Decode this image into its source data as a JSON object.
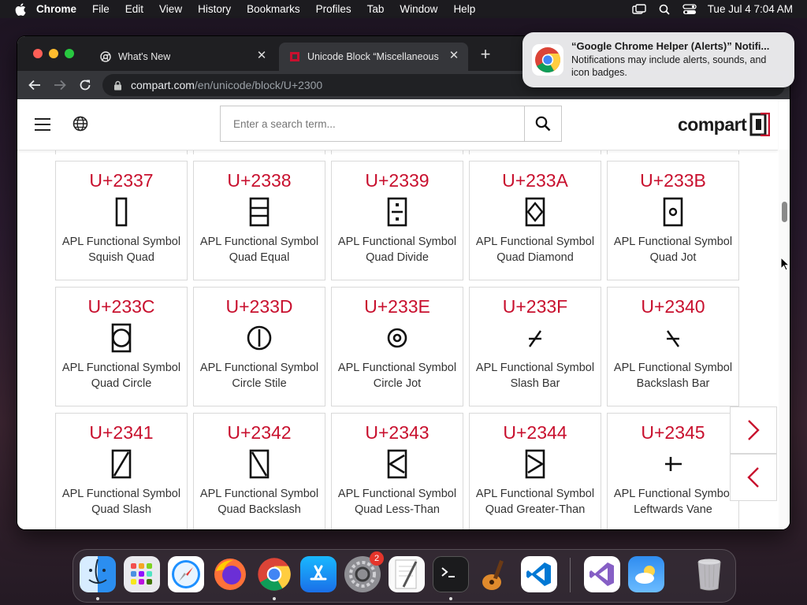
{
  "menubar": {
    "app": "Chrome",
    "items": [
      "File",
      "Edit",
      "View",
      "History",
      "Bookmarks",
      "Profiles",
      "Tab",
      "Window",
      "Help"
    ],
    "datetime": "Tue Jul 4  7:04 AM"
  },
  "browser": {
    "tabs": [
      {
        "label": "What's New",
        "active": false
      },
      {
        "label": "Unicode Block “Miscellaneous",
        "active": true
      }
    ],
    "url_host": "compart.com",
    "url_path": "/en/unicode/block/U+2300"
  },
  "notification": {
    "title": "“Google Chrome Helper (Alerts)” Notifi...",
    "body": "Notifications may include alerts, sounds, and icon badges."
  },
  "site": {
    "search_placeholder": "Enter a search term...",
    "logo_text": "compart"
  },
  "cards": [
    {
      "code": "U+2337",
      "name": "APL Functional Symbol Squish Quad",
      "glyph": "squish-quad"
    },
    {
      "code": "U+2338",
      "name": "APL Functional Symbol Quad Equal",
      "glyph": "quad-equal"
    },
    {
      "code": "U+2339",
      "name": "APL Functional Symbol Quad Divide",
      "glyph": "quad-divide"
    },
    {
      "code": "U+233A",
      "name": "APL Functional Symbol Quad Diamond",
      "glyph": "quad-diamond"
    },
    {
      "code": "U+233B",
      "name": "APL Functional Symbol Quad Jot",
      "glyph": "quad-jot"
    },
    {
      "code": "U+233C",
      "name": "APL Functional Symbol Quad Circle",
      "glyph": "quad-circle"
    },
    {
      "code": "U+233D",
      "name": "APL Functional Symbol Circle Stile",
      "glyph": "circle-stile"
    },
    {
      "code": "U+233E",
      "name": "APL Functional Symbol Circle Jot",
      "glyph": "circle-jot"
    },
    {
      "code": "U+233F",
      "name": "APL Functional Symbol Slash Bar",
      "glyph": "slash-bar"
    },
    {
      "code": "U+2340",
      "name": "APL Functional Symbol Backslash Bar",
      "glyph": "backslash-bar"
    },
    {
      "code": "U+2341",
      "name": "APL Functional Symbol Quad Slash",
      "glyph": "quad-slash"
    },
    {
      "code": "U+2342",
      "name": "APL Functional Symbol Quad Backslash",
      "glyph": "quad-backslash"
    },
    {
      "code": "U+2343",
      "name": "APL Functional Symbol Quad Less-Than",
      "glyph": "quad-less-than"
    },
    {
      "code": "U+2344",
      "name": "APL Functional Symbol Quad Greater-Than",
      "glyph": "quad-greater-than"
    },
    {
      "code": "U+2345",
      "name": "APL Functional Symbol Leftwards Vane",
      "glyph": "leftwards-vane"
    }
  ],
  "dock": {
    "apps": [
      "Finder",
      "Launchpad",
      "Safari",
      "Firefox",
      "Google Chrome",
      "App Store",
      "System Settings",
      "TextEdit",
      "Terminal",
      "GarageBand",
      "Visual Studio Code",
      "Visual Studio",
      "Weather",
      "Trash"
    ],
    "settings_badge": "2"
  },
  "colors": {
    "accent": "#c8102e",
    "tab_bar": "#1f1f22",
    "toolbar": "#35363a"
  }
}
